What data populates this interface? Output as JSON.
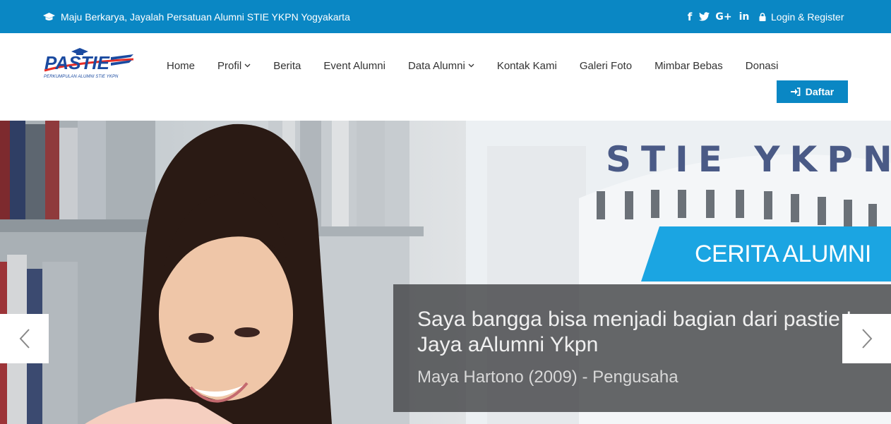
{
  "topbar": {
    "tagline": "Maju Berkarya, Jayalah Persatuan Alumni STIE YKPN Yogyakarta",
    "social": {
      "facebook": "f",
      "google_plus": "G+",
      "linkedin": "in"
    },
    "login_label": "Login & Register",
    "background": "#0a87c4"
  },
  "logo": {
    "text": "PASTIE",
    "subtitle": "PERKUMPULAN ALUMNI STIE YKPN"
  },
  "nav": {
    "items": [
      {
        "label": "Home"
      },
      {
        "label": "Profil"
      },
      {
        "label": "Berita"
      },
      {
        "label": "Event Alumni"
      },
      {
        "label": "Data Alumni"
      },
      {
        "label": "Kontak Kami"
      },
      {
        "label": "Galeri Foto"
      },
      {
        "label": "Mimbar Bebas"
      },
      {
        "label": "Donasi"
      }
    ],
    "daftar_label": "Daftar"
  },
  "hero": {
    "building_sign": "STIE YKPN",
    "banner": "CERITA ALUMNI",
    "quote_line1": "Saya bangga bisa menjadi bagian dari pastie I",
    "quote_line2": "Jaya aAlumni Ykpn",
    "author": "Maya Hartono (2009) - Pengusaha",
    "accent": "#1ba5e2"
  },
  "icons": {
    "tagline": "graduation-cap-icon",
    "login": "lock-icon",
    "daftar": "sign-in-icon",
    "prev": "chevron-left-icon",
    "next": "chevron-right-icon"
  }
}
